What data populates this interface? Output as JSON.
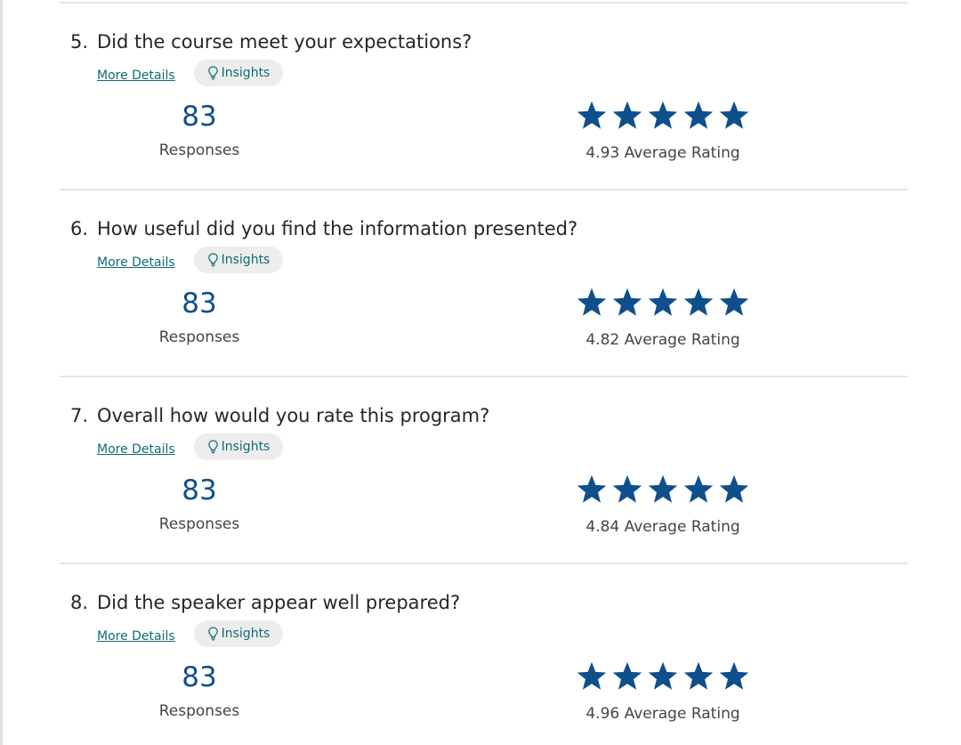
{
  "survey": {
    "questions": [
      {
        "number": "5.",
        "text": "Did the course meet your expectations?",
        "more_details_label": "More Details",
        "insights_label": "Insights",
        "responses": "83",
        "responses_label": "Responses",
        "average_rating": 4.93,
        "average_rating_text": "4.93 Average Rating",
        "max_stars": 5
      },
      {
        "number": "6.",
        "text": "How useful did you find the information presented?",
        "more_details_label": "More Details",
        "insights_label": "Insights",
        "responses": "83",
        "responses_label": "Responses",
        "average_rating": 4.82,
        "average_rating_text": "4.82 Average Rating",
        "max_stars": 5
      },
      {
        "number": "7.",
        "text": "Overall how would you rate this program?",
        "more_details_label": "More Details",
        "insights_label": "Insights",
        "responses": "83",
        "responses_label": "Responses",
        "average_rating": 4.84,
        "average_rating_text": "4.84 Average Rating",
        "max_stars": 5
      },
      {
        "number": "8.",
        "text": "Did the speaker appear well prepared?",
        "more_details_label": "More Details",
        "insights_label": "Insights",
        "responses": "83",
        "responses_label": "Responses",
        "average_rating": 4.96,
        "average_rating_text": "4.96 Average Rating",
        "max_stars": 5
      }
    ]
  },
  "icons": {
    "insights": "lightbulb-icon",
    "rating": "star-icon"
  },
  "colors": {
    "accent": "#0e4f8c",
    "link": "#0f6c74",
    "pill_background": "#ededed"
  }
}
